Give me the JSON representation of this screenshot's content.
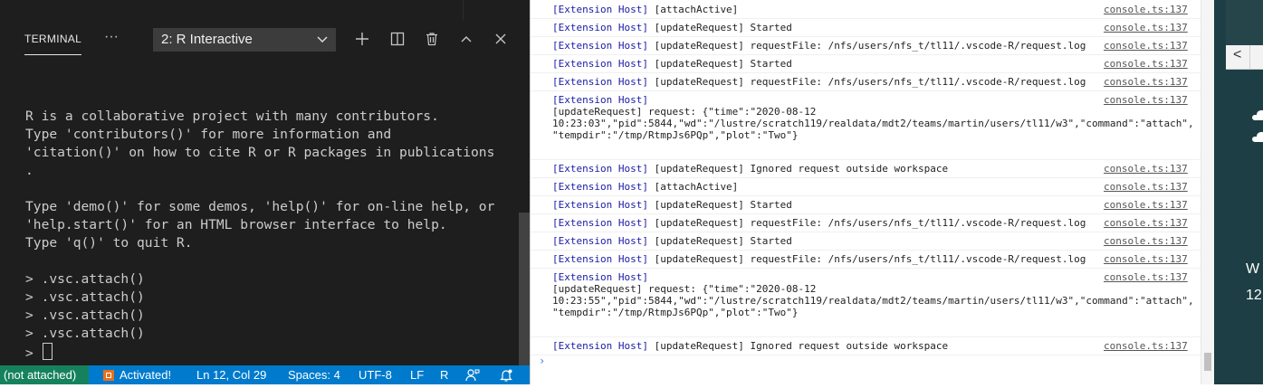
{
  "terminal": {
    "tab_label": "TERMINAL",
    "more_label": "···",
    "selected_terminal": "2: R Interactive",
    "lines": [
      "R is a collaborative project with many contributors.",
      "Type 'contributors()' for more information and",
      "'citation()' on how to cite R or R packages in publications",
      ".",
      "",
      "Type 'demo()' for some demos, 'help()' for on-line help, or",
      "'help.start()' for an HTML browser interface to help.",
      "Type 'q()' to quit R.",
      "",
      "> .vsc.attach()",
      "> .vsc.attach()",
      "> .vsc.attach()",
      "> .vsc.attach()"
    ],
    "prompt": "> "
  },
  "statusbar": {
    "remote": "(not attached)",
    "activated": "Activated!",
    "position": "Ln 12, Col 29",
    "spaces": "Spaces: 4",
    "encoding": "UTF-8",
    "eol": "LF",
    "language": "R"
  },
  "console": {
    "rows": [
      {
        "host": "[Extension Host]",
        "msg": " [attachActive]",
        "src": "console.ts:137"
      },
      {
        "host": "[Extension Host]",
        "msg": " [updateRequest] Started",
        "src": "console.ts:137"
      },
      {
        "host": "[Extension Host]",
        "msg": " [updateRequest] requestFile: /nfs/users/nfs_t/tl11/.vscode-R/request.log",
        "src": "console.ts:137"
      },
      {
        "host": "[Extension Host]",
        "msg": " [updateRequest] Started",
        "src": "console.ts:137"
      },
      {
        "host": "[Extension Host]",
        "msg": " [updateRequest] requestFile: /nfs/users/nfs_t/tl11/.vscode-R/request.log",
        "src": "console.ts:137"
      },
      {
        "host": "[Extension Host]",
        "msg": "\n[updateRequest] request: {\"time\":\"2020-08-12\n10:23:03\",\"pid\":5844,\"wd\":\"/lustre/scratch119/realdata/mdt2/teams/martin/users/tl11/w3\",\"command\":\"attach\",\n\"tempdir\":\"/tmp/RtmpJs6PQp\",\"plot\":\"Two\"}",
        "src": "console.ts:137"
      },
      {
        "host": "[Extension Host]",
        "msg": " [updateRequest] Ignored request outside workspace",
        "src": "console.ts:137"
      },
      {
        "host": "[Extension Host]",
        "msg": " [attachActive]",
        "src": "console.ts:137"
      },
      {
        "host": "[Extension Host]",
        "msg": " [updateRequest] Started",
        "src": "console.ts:137"
      },
      {
        "host": "[Extension Host]",
        "msg": " [updateRequest] requestFile: /nfs/users/nfs_t/tl11/.vscode-R/request.log",
        "src": "console.ts:137"
      },
      {
        "host": "[Extension Host]",
        "msg": " [updateRequest] Started",
        "src": "console.ts:137"
      },
      {
        "host": "[Extension Host]",
        "msg": " [updateRequest] requestFile: /nfs/users/nfs_t/tl11/.vscode-R/request.log",
        "src": "console.ts:137"
      },
      {
        "host": "[Extension Host]",
        "msg": "\n[updateRequest] request: {\"time\":\"2020-08-12\n10:23:55\",\"pid\":5844,\"wd\":\"/lustre/scratch119/realdata/mdt2/teams/martin/users/tl11/w3\",\"command\":\"attach\",\n\"tempdir\":\"/tmp/RtmpJs6PQp\",\"plot\":\"Two\"}",
        "src": "console.ts:137"
      },
      {
        "host": "[Extension Host]",
        "msg": " [updateRequest] Ignored request outside workspace",
        "src": "console.ts:137"
      }
    ],
    "prompt_symbol": "›"
  },
  "desktop": {
    "text_1": "W",
    "text_2": "12",
    "back_arrow": "<"
  }
}
